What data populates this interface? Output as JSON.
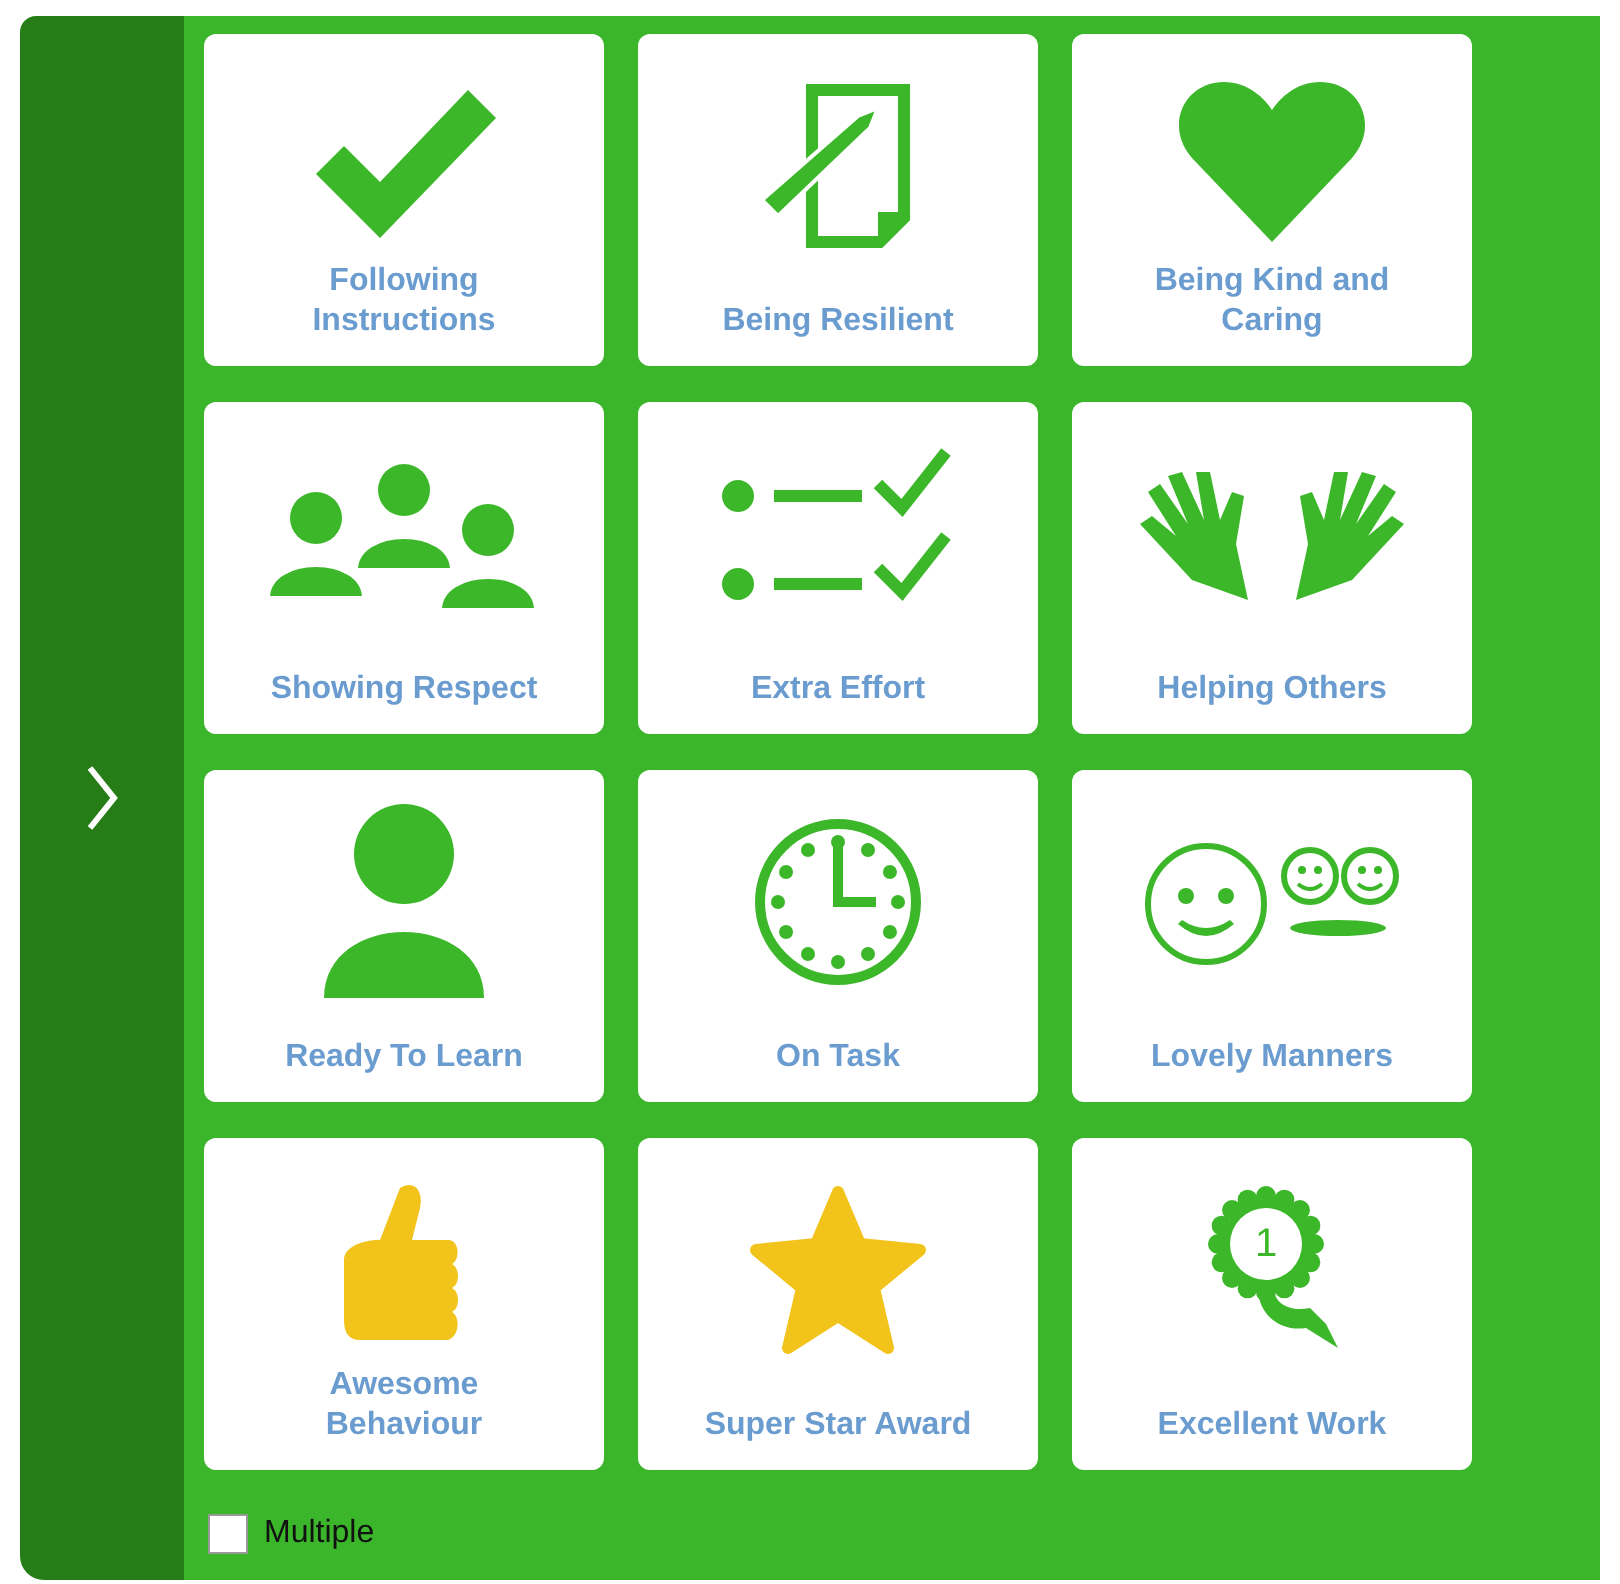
{
  "sidebar": {
    "expanded": false
  },
  "tiles": [
    {
      "label": "Following Instructions"
    },
    {
      "label": "Being Resilient"
    },
    {
      "label": "Being Kind and Caring"
    },
    {
      "label": "Showing Respect"
    },
    {
      "label": "Extra Effort"
    },
    {
      "label": "Helping Others"
    },
    {
      "label": "Ready To Learn"
    },
    {
      "label": "On Task"
    },
    {
      "label": "Lovely Manners"
    },
    {
      "label": "Awesome Behaviour"
    },
    {
      "label": "Super Star Award"
    },
    {
      "label": "Excellent Work",
      "badge": "1"
    }
  ],
  "multiple": {
    "label": "Multiple",
    "checked": false
  }
}
